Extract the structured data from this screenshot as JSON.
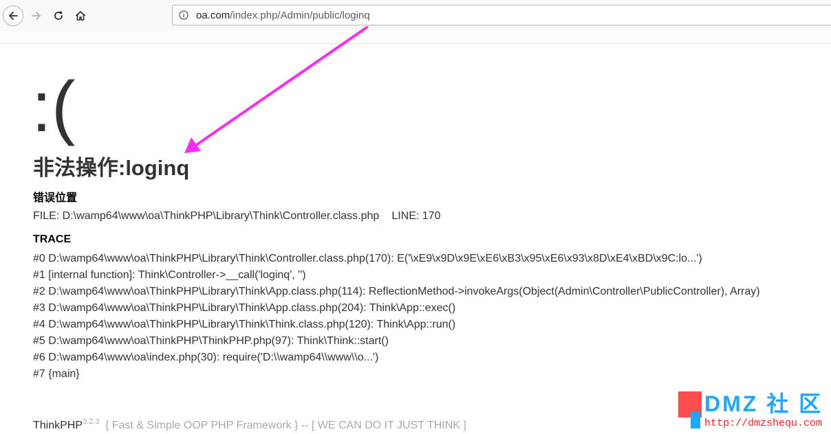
{
  "browser": {
    "url_host": "oa.com",
    "url_path": "/index.php/Admin/public/loginq"
  },
  "error_page": {
    "face": ":(",
    "title": "非法操作:loginq",
    "location_heading": "错误位置",
    "file": "FILE: D:\\wamp64\\www\\oa\\ThinkPHP\\Library\\Think\\Controller.class.php",
    "line": "LINE: 170",
    "trace_heading": "TRACE",
    "trace": [
      "#0 D:\\wamp64\\www\\oa\\ThinkPHP\\Library\\Think\\Controller.class.php(170): E('\\xE9\\x9D\\x9E\\xE6\\xB3\\x95\\xE6\\x93\\x8D\\xE4\\xBD\\x9C:lo...')",
      "#1 [internal function]: Think\\Controller->__call('loginq', '')",
      "#2 D:\\wamp64\\www\\oa\\ThinkPHP\\Library\\Think\\App.class.php(114): ReflectionMethod->invokeArgs(Object(Admin\\Controller\\PublicController), Array)",
      "#3 D:\\wamp64\\www\\oa\\ThinkPHP\\Library\\Think\\App.class.php(204): Think\\App::exec()",
      "#4 D:\\wamp64\\www\\oa\\ThinkPHP\\Library\\Think\\Think.class.php(120): Think\\App::run()",
      "#5 D:\\wamp64\\www\\oa\\ThinkPHP\\ThinkPHP.php(97): Think\\Think::start()",
      "#6 D:\\wamp64\\www\\oa\\index.php(30): require('D:\\\\wamp64\\\\www\\\\o...')",
      "#7 {main}"
    ]
  },
  "footer": {
    "brand": "ThinkPHP",
    "version": "3.2.3",
    "slogan": "{ Fast & Simple OOP PHP Framework } -- [ WE CAN DO IT JUST THINK ]"
  },
  "watermark": {
    "brand": "DMZ 社 区",
    "url": "http://dmzshequ.com"
  },
  "colors": {
    "annotation_arrow": "#ff2bf0",
    "watermark_blue": "#1ea7ff",
    "watermark_red": "#ff4d4d"
  }
}
